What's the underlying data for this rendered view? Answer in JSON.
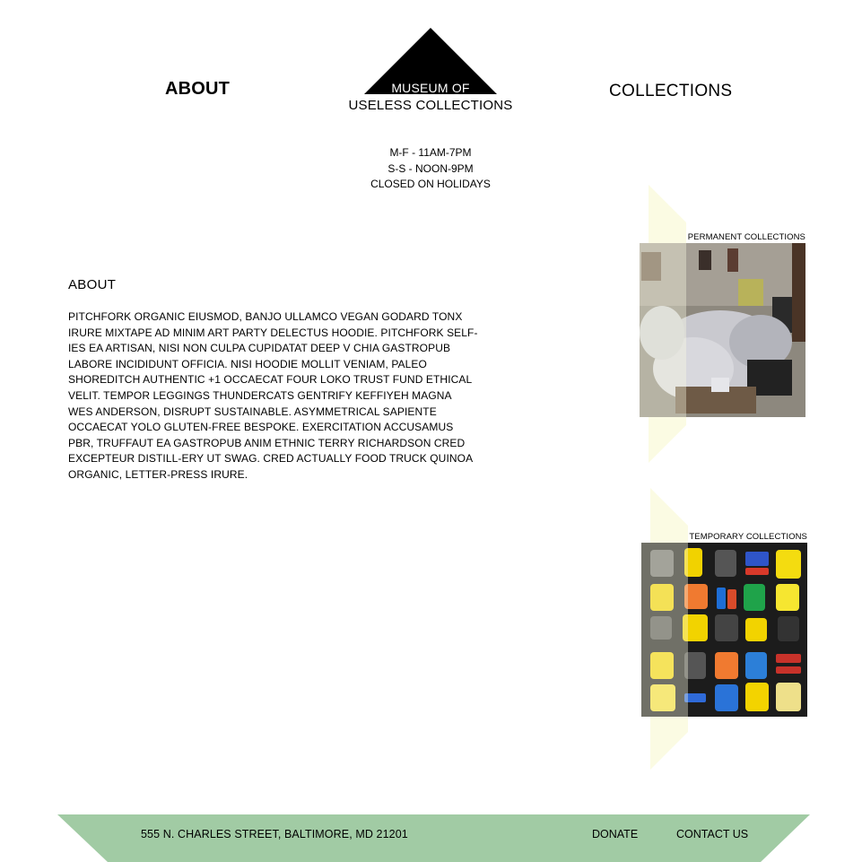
{
  "nav": {
    "about_label": "ABOUT",
    "collections_label": "COLLECTIONS"
  },
  "logo": {
    "line1": "MUSEUM OF",
    "line2": "USELESS COLLECTIONS"
  },
  "hours": {
    "weekday": "M-F - 11AM-7PM",
    "weekend": "S-S - NOON-9PM",
    "holidays": "CLOSED ON HOLIDAYS"
  },
  "about": {
    "title": "ABOUT",
    "body": "PITCHFORK ORGANIC EIUSMOD, BANJO ULLAMCO VEGAN GODARD TONX IRURE MIXTAPE AD MINIM ART PARTY DELECTUS HOODIE. PITCHFORK SELF-IES EA ARTISAN, NISI NON CULPA CUPIDATAT DEEP V CHIA GASTROPUB LABORE INCIDIDUNT OFFICIA. NISI HOODIE MOLLIT VENIAM, PALEO SHOREDITCH AUTHENTIC +1 OCCAECAT FOUR LOKO TRUST FUND ETHICAL VELIT. TEMPOR LEGGINGS THUNDERCATS GENTRIFY KEFFIYEH MAGNA WES ANDERSON, DISRUPT SUSTAINABLE. ASYMMETRICAL SAPIENTE OCCAECAT YOLO GLUTEN-FREE BESPOKE. EXERCITATION ACCUSAMUS PBR, TRUFFAUT EA GASTROPUB ANIM ETHNIC TERRY RICHARDSON CRED EXCEPTEUR DISTILL-ERY UT SWAG. CRED ACTUALLY FOOD TRUCK QUINOA ORGANIC, LETTER-PRESS IRURE."
  },
  "collections": {
    "permanent_label": "PERMANENT COLLECTIONS",
    "temporary_label": "TEMPORARY COLLECTIONS"
  },
  "footer": {
    "address": "555 N. CHARLES STREET, BALTIMORE, MD 21201",
    "donate_label": "DONATE",
    "contact_label": "CONTACT US"
  },
  "colors": {
    "footer_green": "#a1cba4",
    "accent_cream": "#fbfbe3",
    "text": "#000000",
    "background": "#ffffff"
  }
}
